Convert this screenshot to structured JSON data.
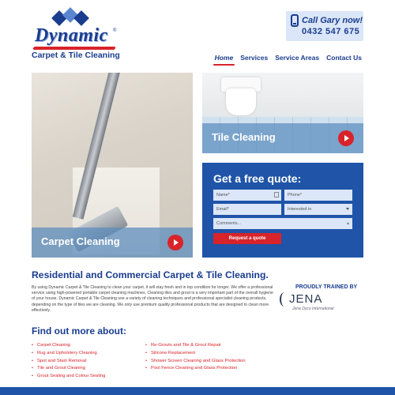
{
  "colors": {
    "brand_blue": "#1a3d8f",
    "accent_red": "#d8232a",
    "quote_blue": "#1f54a8",
    "panel_light": "#dbe7f8"
  },
  "logo": {
    "word": "Dynamic",
    "subtitle": "Carpet & Tile Cleaning",
    "reg_mark": "®"
  },
  "call": {
    "label": "Call Gary now!",
    "number": "0432 547 675",
    "icon": "phone-icon"
  },
  "nav": {
    "items": [
      "Home",
      "Services",
      "Service Areas",
      "Contact Us"
    ],
    "active": "Home"
  },
  "tiles": {
    "carpet": {
      "label": "Carpet Cleaning"
    },
    "tile": {
      "label": "Tile Cleaning"
    }
  },
  "quote": {
    "title": "Get a free quote:",
    "name_placeholder": "Name*",
    "phone_placeholder": "Phone*",
    "email_placeholder": "Email*",
    "interest_placeholder": "Interested in",
    "comments_placeholder": "Comments...",
    "submit_label": "Request a quote"
  },
  "main": {
    "heading": "Residential and Commercial Carpet & Tile Cleaning.",
    "intro": "By using Dynamic Carpet & Tile Cleaning to clean your carpet, it will stay fresh and in top condition for longer. We offer a professional service using high-powered portable carpet cleaning machines. Cleaning tiles and grout is a very important part of the overall hygiene of your house. Dynamic Carpet & Tile Cleaning use a variety of cleaning techniques and professional specialist cleaning products, depending on the type of tiles we are cleaning. We only use premium quality professional products that are designed to clean more effectively."
  },
  "jena": {
    "trained": "PROUDLY TRAINED BY",
    "name": "JENA",
    "sub": "Jena Dyco International"
  },
  "more": {
    "heading": "Find out more about:",
    "left": [
      "Carpet Cleaning",
      "Rug and Upholstery Cleaning",
      "Spot and Stain Removal",
      "Tile and Grout Cleaning",
      "Grout Sealing and Colour Sealing"
    ],
    "right": [
      "Re-Grouts and Tile & Grout Repair",
      "Silicone Replacement",
      "Shower Screen Cleaning and Glass Protection",
      "Pool Fence Cleaning and Glass Protection"
    ]
  }
}
